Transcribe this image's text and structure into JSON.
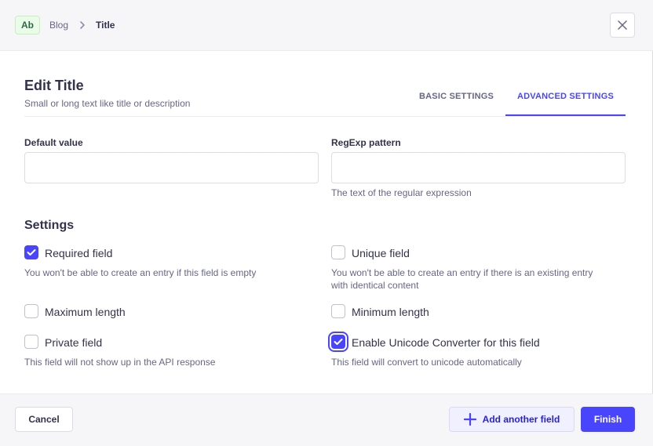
{
  "breadcrumb": {
    "badge": "Ab",
    "parent": "Blog",
    "current": "Title"
  },
  "header": {
    "title": "Edit Title",
    "subtitle": "Small or long text like title or description"
  },
  "tabs": [
    {
      "label": "BASIC SETTINGS",
      "active": false
    },
    {
      "label": "ADVANCED SETTINGS",
      "active": true
    }
  ],
  "fields": {
    "default_value": {
      "label": "Default value",
      "value": "",
      "placeholder": ""
    },
    "regexp": {
      "label": "RegExp pattern",
      "value": "",
      "placeholder": "",
      "hint": "The text of the regular expression"
    }
  },
  "settings": {
    "title": "Settings",
    "required": {
      "label": "Required field",
      "checked": true,
      "hint": "You won't be able to create an entry if this field is empty"
    },
    "unique": {
      "label": "Unique field",
      "checked": false,
      "hint_line1": "You won't be able to create an entry if there is an existing entry",
      "hint_line2": "with identical content"
    },
    "max_length": {
      "label": "Maximum length",
      "checked": false
    },
    "min_length": {
      "label": "Minimum length",
      "checked": false
    },
    "private": {
      "label": "Private field",
      "checked": false,
      "hint": "This field will not show up in the API response"
    },
    "unicode": {
      "label": "Enable Unicode Converter for this field",
      "checked": true,
      "hint": "This field will convert to unicode automatically"
    }
  },
  "footer": {
    "cancel_label": "Cancel",
    "add_label": "Add another field",
    "finish_label": "Finish"
  },
  "colors": {
    "primary": "#4945ff",
    "badge_bg": "#eafbe7",
    "badge_text": "#2f6846"
  },
  "icons": {
    "close": "close-icon",
    "breadcrumb_separator": "chevron-right-icon",
    "check": "check-icon",
    "add": "plus-icon"
  }
}
